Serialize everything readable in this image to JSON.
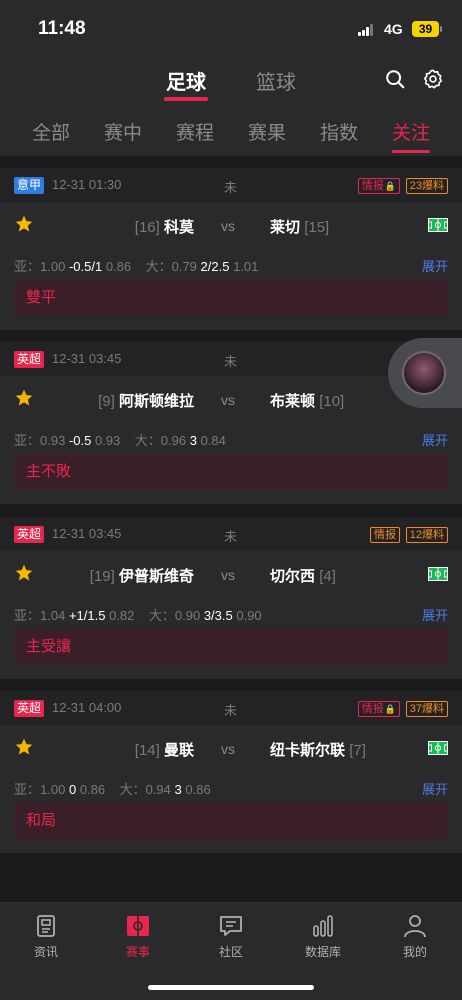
{
  "status_bar": {
    "time": "11:48",
    "network": "4G",
    "battery": "39"
  },
  "header": {
    "sports": [
      "足球",
      "篮球"
    ],
    "tabs": [
      "全部",
      "赛中",
      "赛程",
      "赛果",
      "指数",
      "关注"
    ],
    "active_tab": "关注",
    "search_icon": "search-icon",
    "settings_icon": "gear-icon"
  },
  "colors": {
    "accent": "#e8264d",
    "link": "#4e7be3",
    "league_blue": "#2f7de1",
    "tag_orange": "#f08a24"
  },
  "matches": [
    {
      "league": "意甲",
      "league_color": "#2f7de1",
      "time": "12-31 01:30",
      "status": "未",
      "intel": "情报",
      "count": "23爆料",
      "home_rank": "[16]",
      "home": "科莫",
      "vs": "vs",
      "away": "莱切",
      "away_rank": "[15]",
      "asia_label": "亚：",
      "asia_1": "1.00",
      "asia_line": "-0.5/1",
      "asia_2": "0.86",
      "ou_label": "大：",
      "ou_1": "0.79",
      "ou_line": "2/2.5",
      "ou_2": "1.01",
      "expand": "展开",
      "result": "雙平"
    },
    {
      "league": "英超",
      "league_color": "#e8264d",
      "time": "12-31 03:45",
      "status": "未",
      "intel": "情报",
      "count": "",
      "home_rank": "[9]",
      "home": "阿斯顿维拉",
      "vs": "vs",
      "away": "布莱顿",
      "away_rank": "[10]",
      "asia_label": "亚：",
      "asia_1": "0.93",
      "asia_line": "-0.5",
      "asia_2": "0.93",
      "ou_label": "大：",
      "ou_1": "0.96",
      "ou_line": "3",
      "ou_2": "0.84",
      "expand": "展开",
      "result": "主不敗"
    },
    {
      "league": "英超",
      "league_color": "#e8264d",
      "time": "12-31 03:45",
      "status": "未",
      "intel": "情报",
      "count": "12爆料",
      "home_rank": "[19]",
      "home": "伊普斯维奇",
      "vs": "vs",
      "away": "切尔西",
      "away_rank": "[4]",
      "asia_label": "亚：",
      "asia_1": "1.04",
      "asia_line": "+1/1.5",
      "asia_2": "0.82",
      "ou_label": "大：",
      "ou_1": "0.90",
      "ou_line": "3/3.5",
      "ou_2": "0.90",
      "expand": "展开",
      "result": "主受讓"
    },
    {
      "league": "英超",
      "league_color": "#e8264d",
      "time": "12-31 04:00",
      "status": "未",
      "intel": "情报",
      "count": "37爆料",
      "home_rank": "[14]",
      "home": "曼联",
      "vs": "vs",
      "away": "纽卡斯尔联",
      "away_rank": "[7]",
      "asia_label": "亚：",
      "asia_1": "1.00",
      "asia_line": "0",
      "asia_2": "0.86",
      "ou_label": "大：",
      "ou_1": "0.94",
      "ou_line": "3",
      "ou_2": "0.86",
      "expand": "展开",
      "result": "和局"
    }
  ],
  "tab_bar": [
    {
      "label": "资讯",
      "icon": "news-icon"
    },
    {
      "label": "赛事",
      "icon": "match-icon"
    },
    {
      "label": "社区",
      "icon": "chat-icon"
    },
    {
      "label": "数据库",
      "icon": "chart-icon"
    },
    {
      "label": "我的",
      "icon": "profile-icon"
    }
  ]
}
